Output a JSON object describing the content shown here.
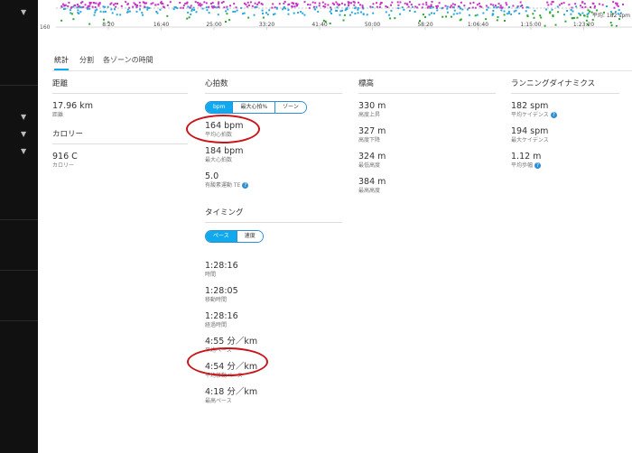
{
  "chart": {
    "y_label": "160",
    "ticks": [
      "8:20",
      "16:40",
      "25:00",
      "33:20",
      "41:40",
      "50:00",
      "58:20",
      "1:06:40",
      "1:15:00",
      "1:23:20"
    ],
    "corner_label": "平均: 182 spm",
    "colors": {
      "magenta": "#c531c5",
      "blue": "#29a7dd",
      "green": "#2fa52f"
    }
  },
  "tabs": [
    "統計",
    "分割",
    "各ゾーンの時間"
  ],
  "distance": {
    "title": "距離",
    "metrics": [
      {
        "value": "17.96 km",
        "label": "距離"
      }
    ]
  },
  "calories": {
    "title": "カロリー",
    "metrics": [
      {
        "value": "916 C",
        "label": "カロリー"
      }
    ]
  },
  "heart_rate": {
    "title": "心拍数",
    "toggle": [
      "bpm",
      "最大心拍%",
      "ゾーン"
    ],
    "metrics": [
      {
        "value": "164 bpm",
        "label": "平均心拍数"
      },
      {
        "value": "184 bpm",
        "label": "最大心拍数"
      },
      {
        "value": "5.0",
        "label": "有酸素運動 TE"
      }
    ]
  },
  "timing": {
    "title": "タイミング",
    "toggle": [
      "ペース",
      "速度"
    ],
    "metrics": [
      {
        "value": "1:28:16",
        "label": "時間"
      },
      {
        "value": "1:28:05",
        "label": "移動時間"
      },
      {
        "value": "1:28:16",
        "label": "経過時間"
      },
      {
        "value": "4:55 分／km",
        "label": "平均ペース"
      },
      {
        "value": "4:54 分／km",
        "label": "平均移動ペース"
      },
      {
        "value": "4:18 分／km",
        "label": "最高ペース"
      }
    ]
  },
  "elevation": {
    "title": "標高",
    "metrics": [
      {
        "value": "330 m",
        "label": "高度上昇"
      },
      {
        "value": "327 m",
        "label": "高度下降"
      },
      {
        "value": "324 m",
        "label": "最低高度"
      },
      {
        "value": "384 m",
        "label": "最高高度"
      }
    ]
  },
  "running_dynamics": {
    "title": "ランニングダイナミクス",
    "metrics": [
      {
        "value": "182 spm",
        "label": "平均ケイデンス"
      },
      {
        "value": "194 spm",
        "label": "最大ケイデンス"
      },
      {
        "value": "1.12 m",
        "label": "平均歩幅"
      }
    ]
  },
  "info_glyph": "?",
  "chevron_glyph": "▼"
}
